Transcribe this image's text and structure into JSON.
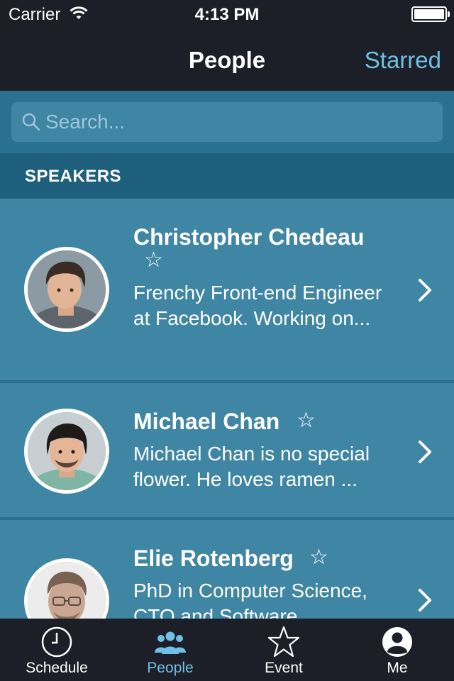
{
  "status_bar": {
    "carrier": "Carrier",
    "time": "4:13 PM"
  },
  "nav": {
    "title": "People",
    "right_button": "Starred"
  },
  "search": {
    "placeholder": "Search..."
  },
  "section": {
    "title": "SPEAKERS"
  },
  "speakers": [
    {
      "name": "Christopher Chedeau",
      "bio": "Frenchy Front-end Engineer at Facebook. Working on...",
      "starred": false,
      "star_icon": "star-outline-icon"
    },
    {
      "name": "Michael Chan",
      "bio": "Michael Chan is no special flower. He loves ramen ...",
      "starred": false,
      "star_icon": "star-outline-icon"
    },
    {
      "name": "Elie Rotenberg",
      "bio": "PhD in Computer Science, CTO and Software ...",
      "starred": false,
      "star_icon": "star-outline-icon"
    }
  ],
  "tabs": [
    {
      "label": "Schedule",
      "icon": "clock-icon",
      "active": false
    },
    {
      "label": "People",
      "icon": "people-icon",
      "active": true
    },
    {
      "label": "Event",
      "icon": "star-icon",
      "active": false
    },
    {
      "label": "Me",
      "icon": "person-icon",
      "active": false
    }
  ],
  "colors": {
    "bar_background": "#1c1f27",
    "accent": "#6fc0e5",
    "row_background": "#3f85a4",
    "section_header": "#1e5f7d",
    "search_background": "#2a7090"
  }
}
